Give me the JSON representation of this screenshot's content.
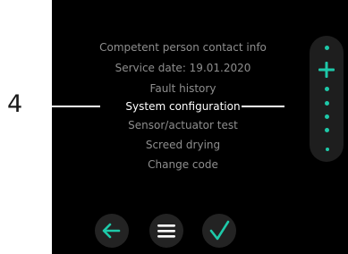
{
  "step": {
    "number": "4"
  },
  "menu": {
    "items": [
      {
        "label": "Competent person contact info",
        "selected": false
      },
      {
        "label": "Service date: 19.01.2020",
        "selected": false
      },
      {
        "label": "Fault history",
        "selected": false
      },
      {
        "label": "System configuration",
        "selected": true
      },
      {
        "label": "Sensor/actuator test",
        "selected": false
      },
      {
        "label": "Screed drying",
        "selected": false
      },
      {
        "label": "Change code",
        "selected": false
      }
    ]
  },
  "footer": {
    "back_icon": "left-arrow-icon",
    "menu_icon": "hamburger-menu-icon",
    "confirm_icon": "checkmark-icon"
  },
  "colors": {
    "accent": "#1ec9a9",
    "screen_bg": "#000000",
    "inactive_text": "#8e8e8e",
    "selected_text": "#ffffff"
  }
}
